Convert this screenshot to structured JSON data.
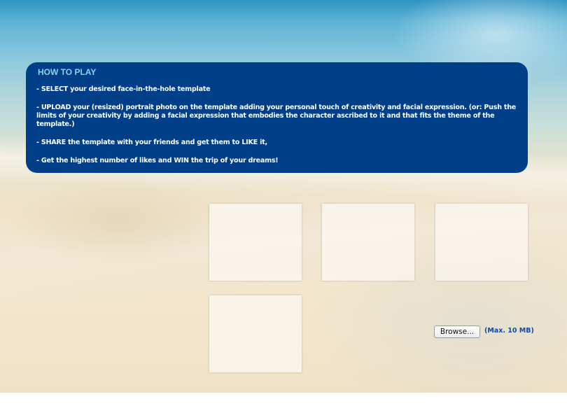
{
  "how_to_play": {
    "title": "HOW TO PLAY",
    "steps": [
      "- SELECT your desired face-in-the-hole template",
      "- UPLOAD your (resized) portrait photo on the template adding your personal touch of creativity and facial expression. (or: Push the limits of your creativity by adding a facial expression that embodies the character ascribed to it and that fits the theme of the template.)",
      "- SHARE the template with your friends and get them to LIKE it,",
      "- Get the highest number of likes and WIN the trip of your dreams!"
    ]
  },
  "templates": {
    "count": 4
  },
  "upload": {
    "browse_label": "Browse...",
    "max_size_label": "(Max. 10 MB)"
  },
  "colors": {
    "panel_background": "#003f87",
    "panel_title": "#8fd0f2",
    "panel_text": "#ffffff",
    "max_size_text": "#17479a"
  }
}
